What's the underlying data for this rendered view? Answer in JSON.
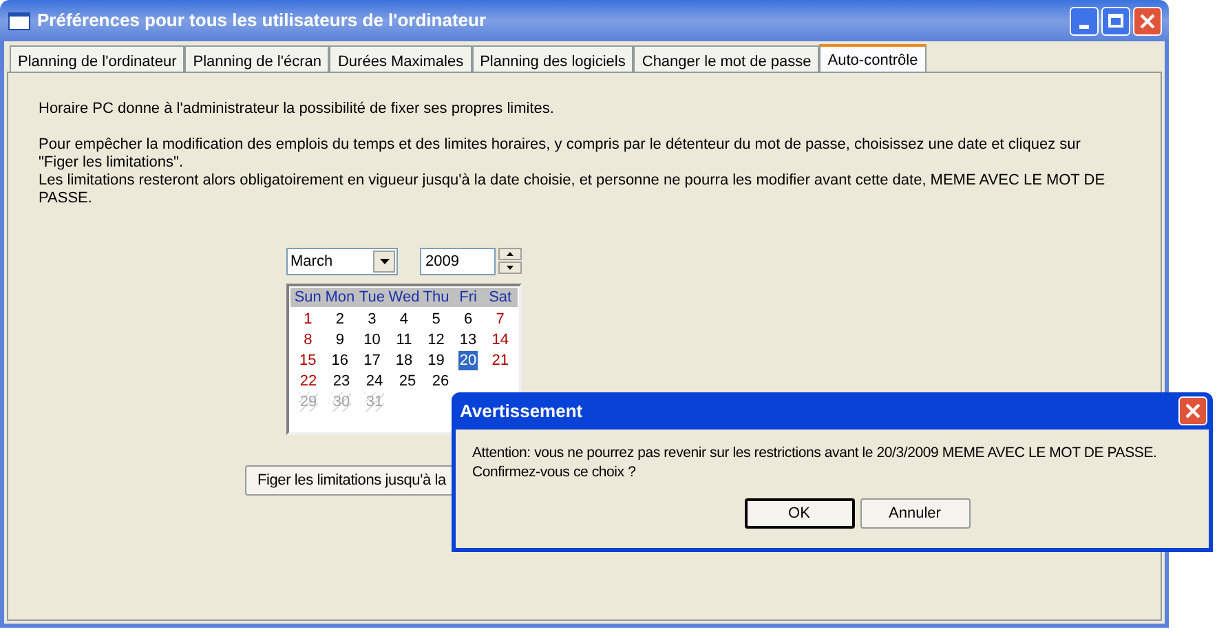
{
  "window": {
    "title": "Préférences pour tous les utilisateurs de l'ordinateur"
  },
  "tabs": [
    {
      "label": "Planning de l'ordinateur",
      "selected": false
    },
    {
      "label": "Planning de l'écran",
      "selected": false
    },
    {
      "label": "Durées Maximales",
      "selected": false
    },
    {
      "label": "Planning des logiciels",
      "selected": false
    },
    {
      "label": "Changer le mot de passe",
      "selected": false
    },
    {
      "label": "Auto-contrôle",
      "selected": true
    }
  ],
  "intro": "Horaire PC donne à l'administrateur la possibilité de fixer ses propres limites.",
  "paragraphs": [
    "Pour empêcher la modification des emplois du temps et des limites horaires, y compris par le détenteur du mot de passe, choisissez une date et cliquez sur \"Figer les limitations\".",
    "Les limitations resteront alors obligatoirement en vigueur jusqu'à la date choisie, et personne ne pourra les modifier avant cette date, MEME AVEC LE MOT DE PASSE."
  ],
  "date_picker": {
    "month": "March",
    "year": "2009",
    "weekdays": [
      "Sun",
      "Mon",
      "Tue",
      "Wed",
      "Thu",
      "Fri",
      "Sat"
    ],
    "weeks": [
      [
        {
          "text": "1",
          "kind": "weekend",
          "selected": false
        },
        {
          "text": "2",
          "kind": "weekday",
          "selected": false
        },
        {
          "text": "3",
          "kind": "weekday",
          "selected": false
        },
        {
          "text": "4",
          "kind": "weekday",
          "selected": false
        },
        {
          "text": "5",
          "kind": "weekday",
          "selected": false
        },
        {
          "text": "6",
          "kind": "weekday",
          "selected": false
        },
        {
          "text": "7",
          "kind": "weekend",
          "selected": false
        }
      ],
      [
        {
          "text": "8",
          "kind": "weekend",
          "selected": false
        },
        {
          "text": "9",
          "kind": "weekday",
          "selected": false
        },
        {
          "text": "10",
          "kind": "weekday",
          "selected": false
        },
        {
          "text": "11",
          "kind": "weekday",
          "selected": false
        },
        {
          "text": "12",
          "kind": "weekday",
          "selected": false
        },
        {
          "text": "13",
          "kind": "weekday",
          "selected": false
        },
        {
          "text": "14",
          "kind": "weekend",
          "selected": false
        }
      ],
      [
        {
          "text": "15",
          "kind": "weekend",
          "selected": false
        },
        {
          "text": "16",
          "kind": "weekday",
          "selected": false
        },
        {
          "text": "17",
          "kind": "weekday",
          "selected": false
        },
        {
          "text": "18",
          "kind": "weekday",
          "selected": false
        },
        {
          "text": "19",
          "kind": "weekday",
          "selected": false
        },
        {
          "text": "20",
          "kind": "weekday",
          "selected": true
        },
        {
          "text": "21",
          "kind": "weekend",
          "selected": false
        }
      ],
      [
        {
          "text": "22",
          "kind": "weekend",
          "selected": false
        },
        {
          "text": "23",
          "kind": "weekday",
          "selected": false
        },
        {
          "text": "24",
          "kind": "weekday",
          "selected": false
        },
        {
          "text": "25",
          "kind": "weekday",
          "selected": false
        },
        {
          "text": "26",
          "kind": "weekday",
          "selected": false
        }
      ],
      [
        {
          "text": "29",
          "kind": "disabled",
          "selected": false
        },
        {
          "text": "30",
          "kind": "disabled",
          "selected": false
        },
        {
          "text": "31",
          "kind": "disabled",
          "selected": false
        }
      ]
    ]
  },
  "freeze_button": "Figer les limitations jusqu'à la",
  "dialog": {
    "title": "Avertissement",
    "message": [
      "Attention: vous ne pourrez pas revenir sur les restrictions avant  le 20/3/2009 MEME AVEC LE MOT DE PASSE.",
      "Confirmez-vous ce choix ?"
    ],
    "buttons": [
      {
        "label": "OK",
        "default": true
      },
      {
        "label": "Annuler",
        "default": false
      }
    ]
  }
}
